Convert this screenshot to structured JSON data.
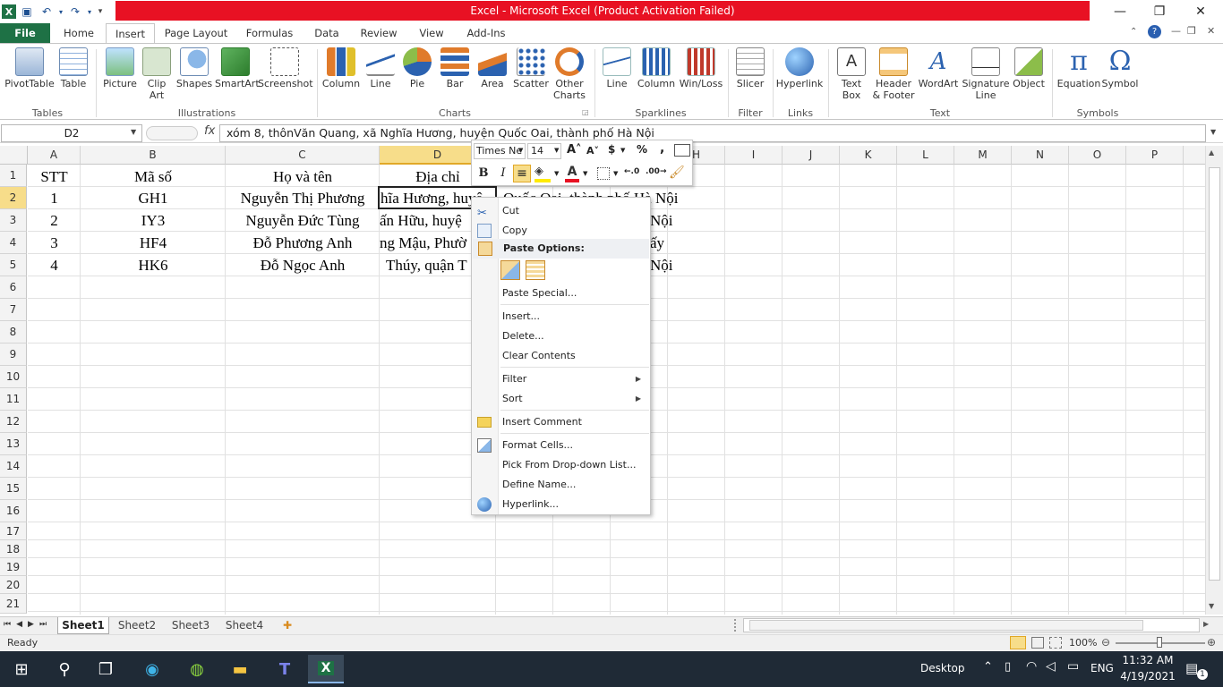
{
  "title_bar": {
    "title": "Excel - Microsoft Excel (Product Activation Failed)",
    "minimize": "—",
    "restore": "❐",
    "close": "✕"
  },
  "ribbon_tabs": [
    "File",
    "Home",
    "Insert",
    "Page Layout",
    "Formulas",
    "Data",
    "Review",
    "View",
    "Add-Ins"
  ],
  "ribbon": {
    "groups": [
      {
        "label": "Tables",
        "buttons": [
          "PivotTable",
          "Table"
        ]
      },
      {
        "label": "Illustrations",
        "buttons": [
          "Picture",
          "Clip Art",
          "Shapes",
          "SmartArt",
          "Screenshot"
        ]
      },
      {
        "label": "Charts",
        "buttons": [
          "Column",
          "Line",
          "Pie",
          "Bar",
          "Area",
          "Scatter",
          "Other Charts"
        ]
      },
      {
        "label": "Sparklines",
        "buttons": [
          "Line",
          "Column",
          "Win/Loss"
        ]
      },
      {
        "label": "Filter",
        "buttons": [
          "Slicer"
        ]
      },
      {
        "label": "Links",
        "buttons": [
          "Hyperlink"
        ]
      },
      {
        "label": "Text",
        "buttons": [
          "Text Box",
          "Header & Footer",
          "WordArt",
          "Signature Line",
          "Object"
        ]
      },
      {
        "label": "Symbols",
        "buttons": [
          "Equation",
          "Symbol"
        ]
      }
    ]
  },
  "formula_bar": {
    "name_box": "D2",
    "fx": "fx",
    "formula": "xóm 8, thônVăn Quang, xã Nghĩa Hương, huyện Quốc Oai, thành phố Hà Nội"
  },
  "columns": [
    "A",
    "B",
    "C",
    "D",
    "E",
    "F",
    "G",
    "H",
    "I",
    "J",
    "K",
    "L",
    "M",
    "N",
    "O",
    "P"
  ],
  "rows": [
    "1",
    "2",
    "3",
    "4",
    "5",
    "6",
    "7",
    "8",
    "9",
    "10",
    "11",
    "12",
    "13",
    "14",
    "15",
    "16",
    "17",
    "18",
    "19",
    "20",
    "21"
  ],
  "cells": {
    "header": [
      "STT",
      "Mã số",
      "Họ và tên",
      "Địa chỉ"
    ],
    "r2": [
      "1",
      "GH1",
      "Nguyễn Thị Phương",
      "hĩa Hương, huyệ",
      "Quốc Oai, thành phố Hà Nội"
    ],
    "r3": [
      "2",
      "IY3",
      "Nguyễn Đức Tùng",
      "ấn Hữu, huyệ",
      "Nội"
    ],
    "r4": [
      "3",
      "HF4",
      "Đỗ Phương Anh",
      "ng Mậu, Phườ",
      "ấy"
    ],
    "r5": [
      "4",
      "HK6",
      "Đỗ Ngọc Anh",
      "Thúy, quận T",
      "Nội"
    ]
  },
  "mini_toolbar": {
    "font": "Times Ne",
    "size": "14",
    "bold": "B",
    "italic": "I"
  },
  "context_menu": {
    "items": [
      "Cut",
      "Copy",
      "Paste Options:",
      "Paste Special...",
      "Insert...",
      "Delete...",
      "Clear Contents",
      "Filter",
      "Sort",
      "Insert Comment",
      "Format Cells...",
      "Pick From Drop-down List...",
      "Define Name...",
      "Hyperlink..."
    ]
  },
  "sheets": [
    "Sheet1",
    "Sheet2",
    "Sheet3",
    "Sheet4"
  ],
  "status": {
    "ready": "Ready",
    "zoom": "100%"
  },
  "taskbar": {
    "desktop": "Desktop",
    "lang": "ENG",
    "time": "11:32 AM",
    "date": "4/19/2021",
    "notif_count": "1"
  },
  "colors": {
    "title_red": "#e81123",
    "file_green": "#1e7145",
    "selected_header": "#f7dd8a",
    "taskbar": "#1f2a36"
  }
}
